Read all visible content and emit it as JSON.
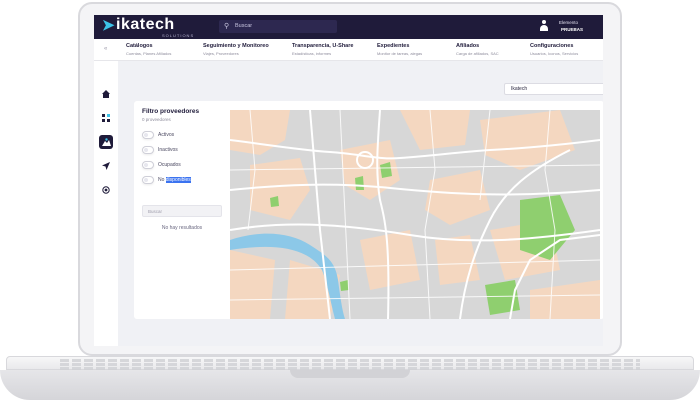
{
  "brand": {
    "name": "ikatech",
    "tagline": "SOLUTIONS",
    "accent": "#3cc3e8",
    "header_bg": "#1f1b3a"
  },
  "header": {
    "search_placeholder": "Buscar",
    "user_name": "Elemento",
    "user_role": "PRUEBAS",
    "icons": [
      "search-icon",
      "user-icon"
    ]
  },
  "menu": [
    {
      "title": "Catálogos",
      "subtitle": "Cuentas, Planes Afiliados"
    },
    {
      "title": "Seguimiento y Monitoreo",
      "subtitle": "Viajes, Proveedores"
    },
    {
      "title": "Transparencia, U-Share",
      "subtitle": "Estadísticas, informes"
    },
    {
      "title": "Expedientes",
      "subtitle": "Monitor de tareas, alegas"
    },
    {
      "title": "Afiliados",
      "subtitle": "Carga de afiliados, SAC"
    },
    {
      "title": "Configuraciones",
      "subtitle": "Usuarios, Iconos, Servicios"
    }
  ],
  "rail": [
    "home-icon",
    "grid-icon",
    "map-pin-icon",
    "send-icon",
    "target-icon"
  ],
  "account_select": {
    "value": "Ikatech"
  },
  "filter_panel": {
    "title": "Filtro proveedores",
    "count": "0 proveedores",
    "toggles": [
      {
        "label": "Activos"
      },
      {
        "label": "Inactivos"
      },
      {
        "label": "Ocupados"
      },
      {
        "label_plain": "No ",
        "label_highlight": "disponibles"
      }
    ],
    "search_placeholder": "Buscar",
    "empty_text": "No hay resultados"
  },
  "colors": {
    "map_base": "#d7d7d7",
    "map_urban": "#f4d7c0",
    "map_park": "#8fcf6f",
    "map_water": "#8cc8e8",
    "highlight": "#3b73f0",
    "notification": "#e53b3b"
  }
}
